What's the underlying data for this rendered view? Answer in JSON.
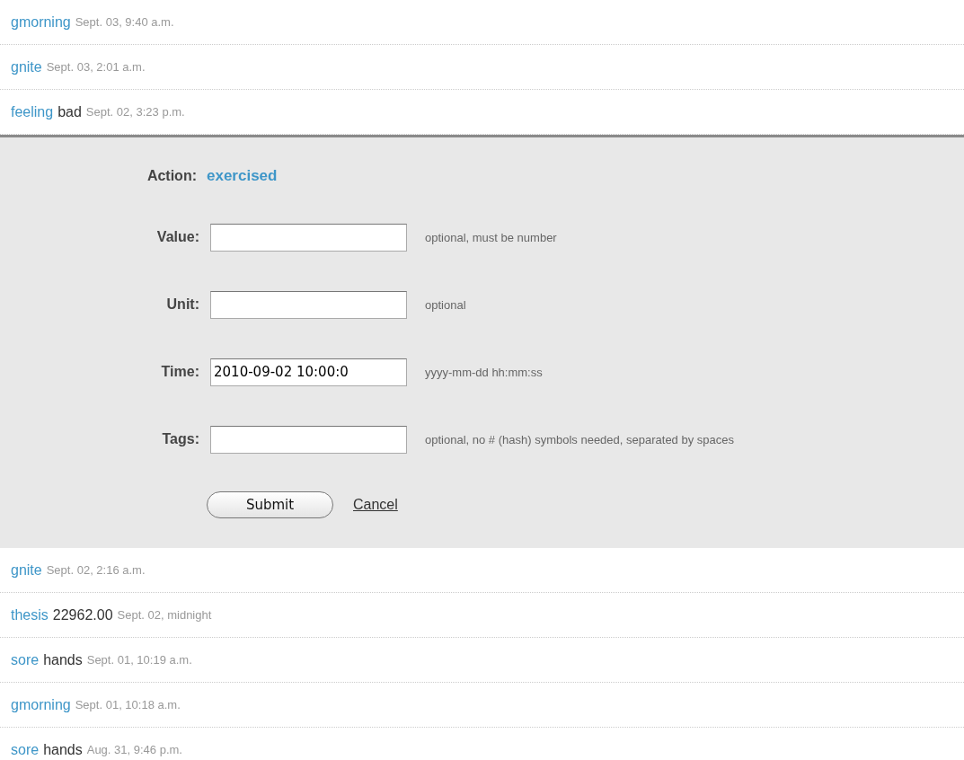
{
  "entries_above": [
    {
      "action": "gmorning",
      "time": "Sept. 03, 9:40 a.m."
    },
    {
      "action": "gnite",
      "time": "Sept. 03, 2:01 a.m."
    },
    {
      "action": "feeling",
      "value": "bad",
      "time": "Sept. 02, 3:23 p.m."
    }
  ],
  "form": {
    "action_label": "Action:",
    "action": "exercised",
    "fields": [
      {
        "label": "Value:",
        "hint": "optional, must be number"
      },
      {
        "label": "Unit:",
        "hint": "optional"
      },
      {
        "label": "Time:",
        "value": "2010-09-02 10:00:0",
        "hint": "yyyy-mm-dd hh:mm:ss"
      },
      {
        "label": "Tags:",
        "hint": "optional, no # (hash) symbols needed, separated by spaces"
      }
    ],
    "submit": "Submit",
    "cancel": "Cancel"
  },
  "entries_below": [
    {
      "action": "gnite",
      "time": "Sept. 02, 2:16 a.m."
    },
    {
      "action": "thesis",
      "value": "22962.00",
      "time": "Sept. 02, midnight"
    },
    {
      "action": "sore",
      "value": "hands",
      "time": "Sept. 01, 10:19 a.m."
    },
    {
      "action": "gmorning",
      "time": "Sept. 01, 10:18 a.m."
    },
    {
      "action": "sore",
      "value": "hands",
      "time": "Aug. 31, 9:46 p.m."
    }
  ]
}
